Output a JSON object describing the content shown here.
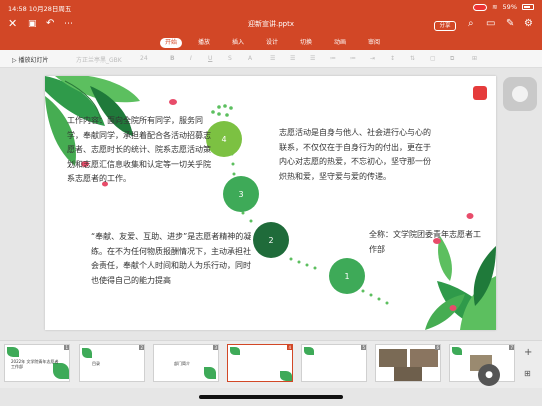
{
  "status": {
    "time_date": "14:58  10月28日周五",
    "battery": "59%"
  },
  "titlebar": {
    "file_name": "迎新宣讲.pptx",
    "share_label": "分享"
  },
  "tabs": [
    "开始",
    "播放",
    "插入",
    "设计",
    "切换",
    "动画",
    "审阅"
  ],
  "active_tab": "开始",
  "toolbar": {
    "play_label": "播放幻灯片",
    "font_size": "24",
    "font_name": "方正兰亭黑_GBK"
  },
  "slide": {
    "circles": [
      "4",
      "3",
      "2",
      "1"
    ],
    "text_work": "工作内容：面向全院所有同学，服务同学，奉献同学，承担着配合各活动招募志愿者、志愿时长的统计、院系志愿活动策划和志愿汇信息收集和认定等一切关乎院系志愿者的工作。",
    "text_spirit": "志愿活动是自身与他人、社会进行心与心的联系，不仅仅在于自身行为的付出，更在于内心对志愿的热爱，不忘初心，坚守那一份炽热和爱，坚守爱与爱的传递。",
    "text_motto": "“奉献、友爱、互助、进步”是志愿者精神的凝练。在不为任何物质报酬情况下，主动承担社会责任，奉献个人时间和助人为乐行动，同时也使得自己的能力提高",
    "text_name": "全称：文学院团委青年志愿者工作部"
  },
  "thumbnails": [
    {
      "num": "1",
      "text": "2022年 文学院青年志愿者工作部"
    },
    {
      "num": "2",
      "text": "目录"
    },
    {
      "num": "3",
      "text": "部门简介"
    },
    {
      "num": "4",
      "text": ""
    },
    {
      "num": "5",
      "text": ""
    },
    {
      "num": "6",
      "text": ""
    },
    {
      "num": "7",
      "text": ""
    }
  ],
  "active_slide": "5",
  "colors": {
    "accent": "#d24726",
    "green_dark": "#1f6b3a",
    "green_mid": "#3eaa58",
    "green_light": "#6ec256"
  }
}
